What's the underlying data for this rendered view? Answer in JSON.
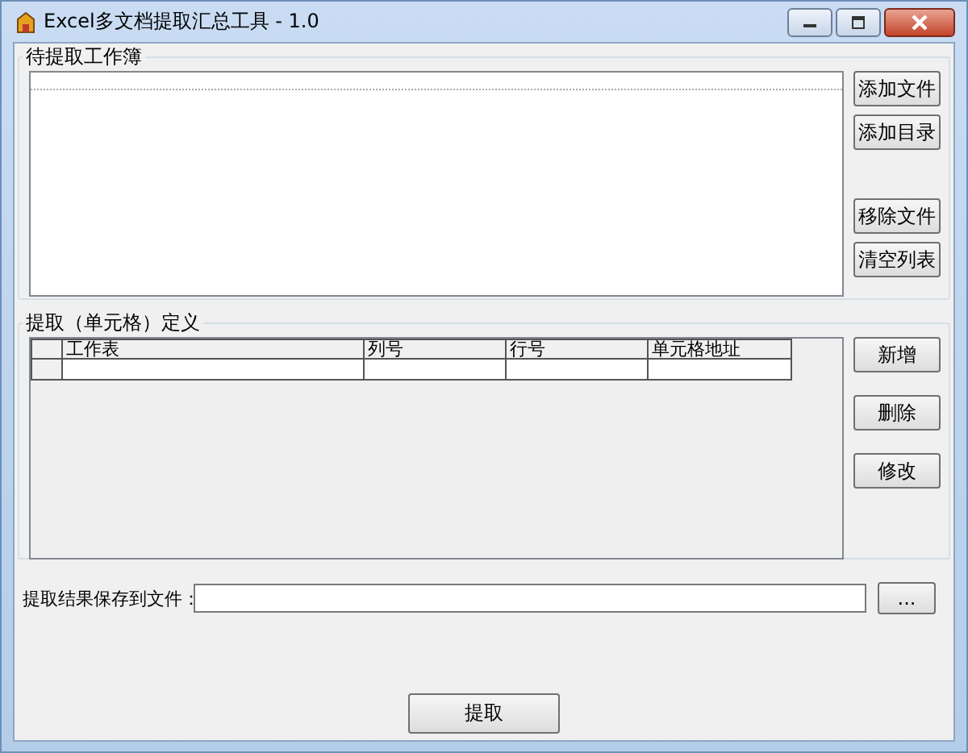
{
  "window": {
    "title": "Excel多文档提取汇总工具 - 1.0"
  },
  "workbooks": {
    "title": "待提取工作簿",
    "buttons": [
      "添加文件",
      "添加目录",
      "移除文件",
      "清空列表"
    ]
  },
  "definition": {
    "title": "提取（单元格）定义",
    "columns": [
      "工作表",
      "列号",
      "行号",
      "单元格地址"
    ],
    "buttons": [
      "新增",
      "删除",
      "修改"
    ]
  },
  "output": {
    "label": "提取结果保存到文件：",
    "browse": "..."
  },
  "extract_button": "提取"
}
